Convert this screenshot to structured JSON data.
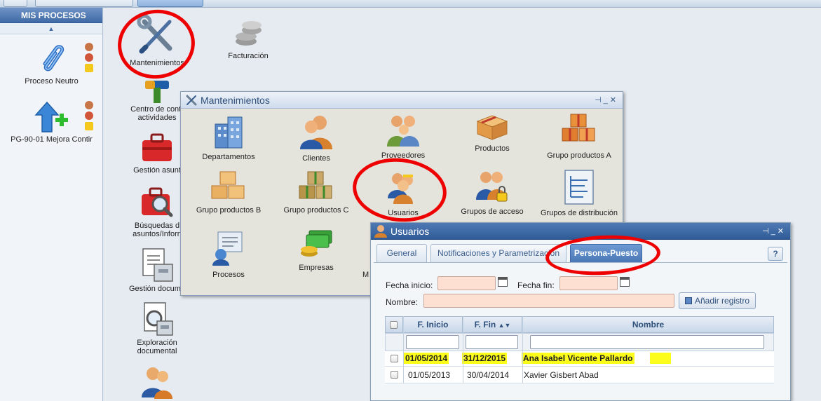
{
  "left_panel": {
    "header": "MIS PROCESOS",
    "processes": [
      {
        "label": "Proceso Neutro",
        "icon": "paperclip-icon"
      },
      {
        "label": "PG-90-01 Mejora Contir",
        "icon": "upload-plus-icon"
      }
    ]
  },
  "desktop": {
    "icons": [
      {
        "label": "Mantenimientos",
        "icon": "wrench-screwdriver-icon"
      },
      {
        "label": "Facturación",
        "icon": "coins-icon"
      },
      {
        "label": "Centro de contr\nactividades",
        "icon": "hammer-icon"
      },
      {
        "label": "Gestión asunt",
        "icon": "briefcase-icon"
      },
      {
        "label": "Búsquedas d\nasuntos/Inforn",
        "icon": "briefcase-search-icon"
      },
      {
        "label": "Gestión docume",
        "icon": "document-cabinet-icon"
      },
      {
        "label": "Exploración\ndocumental",
        "icon": "document-explore-icon"
      },
      {
        "label": "",
        "icon": "users-icon"
      }
    ]
  },
  "mantenimientos_window": {
    "title": "Mantenimientos",
    "items": [
      {
        "label": "Departamentos",
        "icon": "building-icon"
      },
      {
        "label": "Clientes",
        "icon": "clients-icon"
      },
      {
        "label": "Proveedores",
        "icon": "suppliers-icon"
      },
      {
        "label": "Productos",
        "icon": "box-icon"
      },
      {
        "label": "Grupo productos A",
        "icon": "boxes-a-icon"
      },
      {
        "label": "Grupo productos B",
        "icon": "boxes-b-icon"
      },
      {
        "label": "Grupo productos C",
        "icon": "boxes-c-icon"
      },
      {
        "label": "Usuarios",
        "icon": "users-icon"
      },
      {
        "label": "Grupos de acceso",
        "icon": "access-groups-icon"
      },
      {
        "label": "Grupos de distribución",
        "icon": "distribution-groups-icon"
      },
      {
        "label": "Procesos",
        "icon": "processes-icon"
      },
      {
        "label": "Empresas",
        "icon": "money-icon"
      },
      {
        "label": "M",
        "icon": ""
      }
    ]
  },
  "usuarios_window": {
    "title": "Usuarios",
    "tabs": [
      "General",
      "Notificaciones y Parametrización",
      "Persona-Puesto"
    ],
    "active_tab": "Persona-Puesto",
    "help_label": "?",
    "form": {
      "fecha_inicio_label": "Fecha inicio:",
      "fecha_fin_label": "Fecha fin:",
      "nombre_label": "Nombre:",
      "add_button": "Añadir registro"
    },
    "grid": {
      "columns": [
        "F. Inicio",
        "F. Fin",
        "Nombre"
      ],
      "rows": [
        {
          "inicio": "01/05/2014",
          "fin": "31/12/2015",
          "nombre": "Ana Isabel Vicente Pallardo",
          "highlighted": true
        },
        {
          "inicio": "01/05/2013",
          "fin": "30/04/2014",
          "nombre": "Xavier Gisbert Abad",
          "highlighted": false
        }
      ]
    }
  },
  "colors": {
    "annotation_circle": "#ee0000",
    "highlight": "#fdfd1c",
    "title_bar_blue": "#3f6aa6",
    "input_pink": "#fde0d2"
  }
}
